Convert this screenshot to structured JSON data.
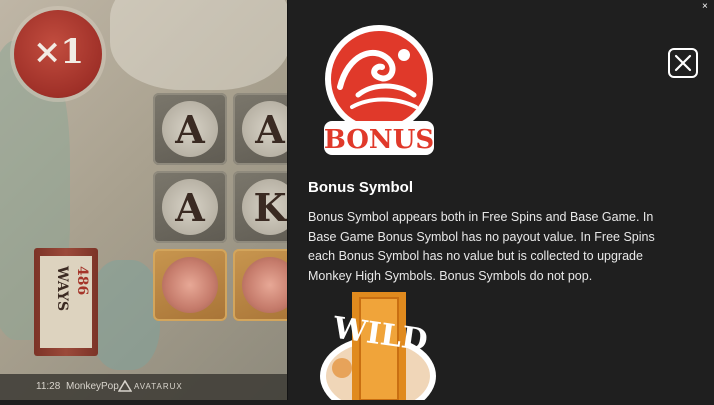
{
  "game": {
    "multiplier": "×1",
    "reels": [
      [
        "A",
        "A"
      ],
      [
        "A",
        "K"
      ]
    ],
    "ways_label": "WAYS",
    "ways_value": "486"
  },
  "statusbar": {
    "time": "11:28",
    "game_name": "MonkeyPop",
    "brand": "AVATARUX"
  },
  "panel": {
    "bonus_logo_text": "BONUS",
    "symbol_title": "Bonus Symbol",
    "symbol_description": "Bonus Symbol appears both in Free Spins and Base Game. In Base Game Bonus Symbol has no payout value. In Free Spins each Bonus Symbol has no value but is collected to upgrade Monkey High Symbols. Bonus Symbols do not pop.",
    "wild_logo_text": "WILD",
    "close_icon": "close-icon",
    "corner_close_glyph": "×"
  },
  "colors": {
    "panel_bg": "#1f1f1f",
    "bonus_red": "#e0392a",
    "wild_orange": "#e08a1e"
  }
}
